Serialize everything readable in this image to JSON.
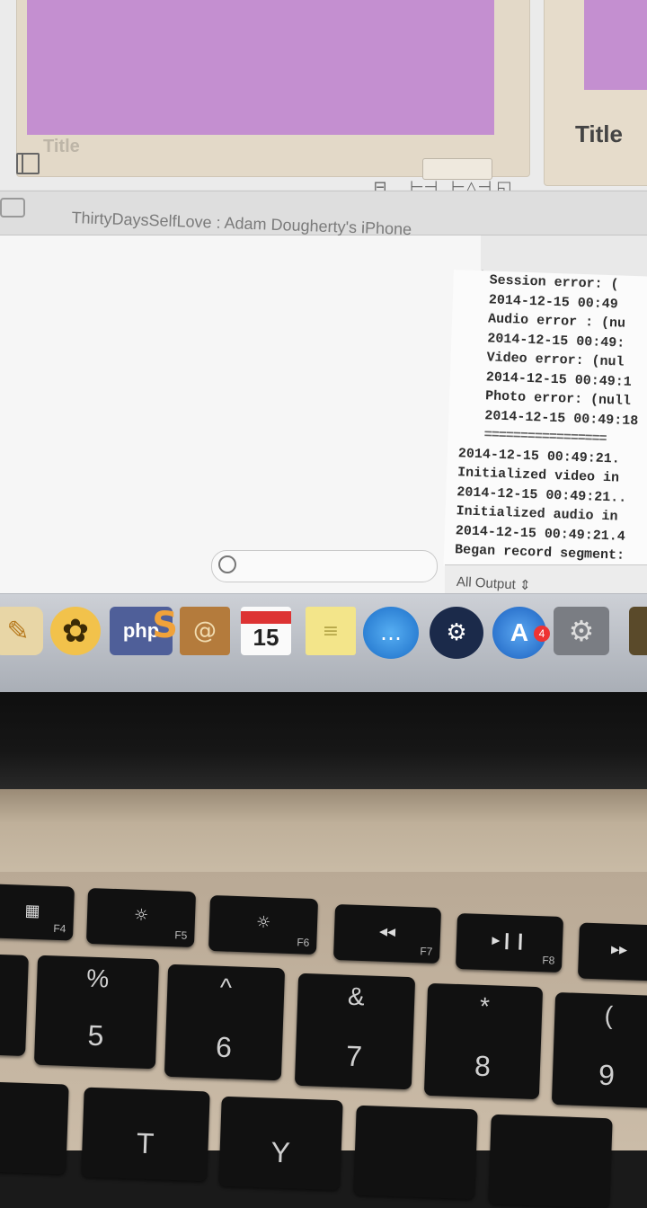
{
  "storyboard": {
    "scene_title_ghost": "Title",
    "scene_title": "Title"
  },
  "toolbar": {
    "icons": [
      "align-icon",
      "pin-icon",
      "resolve-icon",
      "resize-icon"
    ],
    "add_label": "+"
  },
  "debug_bar": {
    "path": "ThirtyDaysSelfLove : Adam Dougherty's iPhone"
  },
  "console": {
    "lines_a": [
      "Session error: (",
      "2014-12-15 00:49",
      "Audio error : (nu",
      "2014-12-15 00:49:",
      "Video error: (nul",
      "2014-12-15 00:49:1",
      "Photo error: (null",
      "2014-12-15 00:49:18",
      "================="
    ],
    "lines_b": [
      "2014-12-15 00:49:21.",
      "Initialized video in",
      "2014-12-15 00:49:21..",
      "Initialized audio in",
      "2014-12-15 00:49:21.4",
      "Began record segment:"
    ],
    "output_selector": "All Output ⇕"
  },
  "dock": {
    "apps": [
      {
        "name": "pages-icon",
        "glyph": "✎"
      },
      {
        "name": "flower-app-icon",
        "glyph": "✿"
      },
      {
        "name": "php-icon",
        "label": "php",
        "mark": "S"
      },
      {
        "name": "contacts-icon",
        "glyph": "@"
      },
      {
        "name": "calendar-icon",
        "label": "15"
      },
      {
        "name": "stickies-icon",
        "glyph": "≡"
      },
      {
        "name": "messages-icon",
        "glyph": "…"
      },
      {
        "name": "steam-icon",
        "glyph": "⚙"
      },
      {
        "name": "app-store-icon",
        "label": "A",
        "badge": "4"
      },
      {
        "name": "system-preferences-icon",
        "glyph": "⚙"
      }
    ]
  },
  "keyboard": {
    "fn_row": [
      {
        "glyph": "▦",
        "fn": "F4"
      },
      {
        "glyph": "☼",
        "fn": "F5"
      },
      {
        "glyph": "☼",
        "fn": "F6"
      },
      {
        "glyph": "◂◂",
        "fn": "F7"
      },
      {
        "glyph": "▸❙❙",
        "fn": "F8"
      },
      {
        "glyph": "▸▸",
        "fn": ""
      }
    ],
    "num_row": [
      {
        "top": "%",
        "bot": "5"
      },
      {
        "top": "^",
        "bot": "6"
      },
      {
        "top": "&",
        "bot": "7"
      },
      {
        "top": "*",
        "bot": "8"
      },
      {
        "top": "(",
        "bot": "9"
      }
    ],
    "letter_row": [
      "T",
      "Y"
    ]
  }
}
